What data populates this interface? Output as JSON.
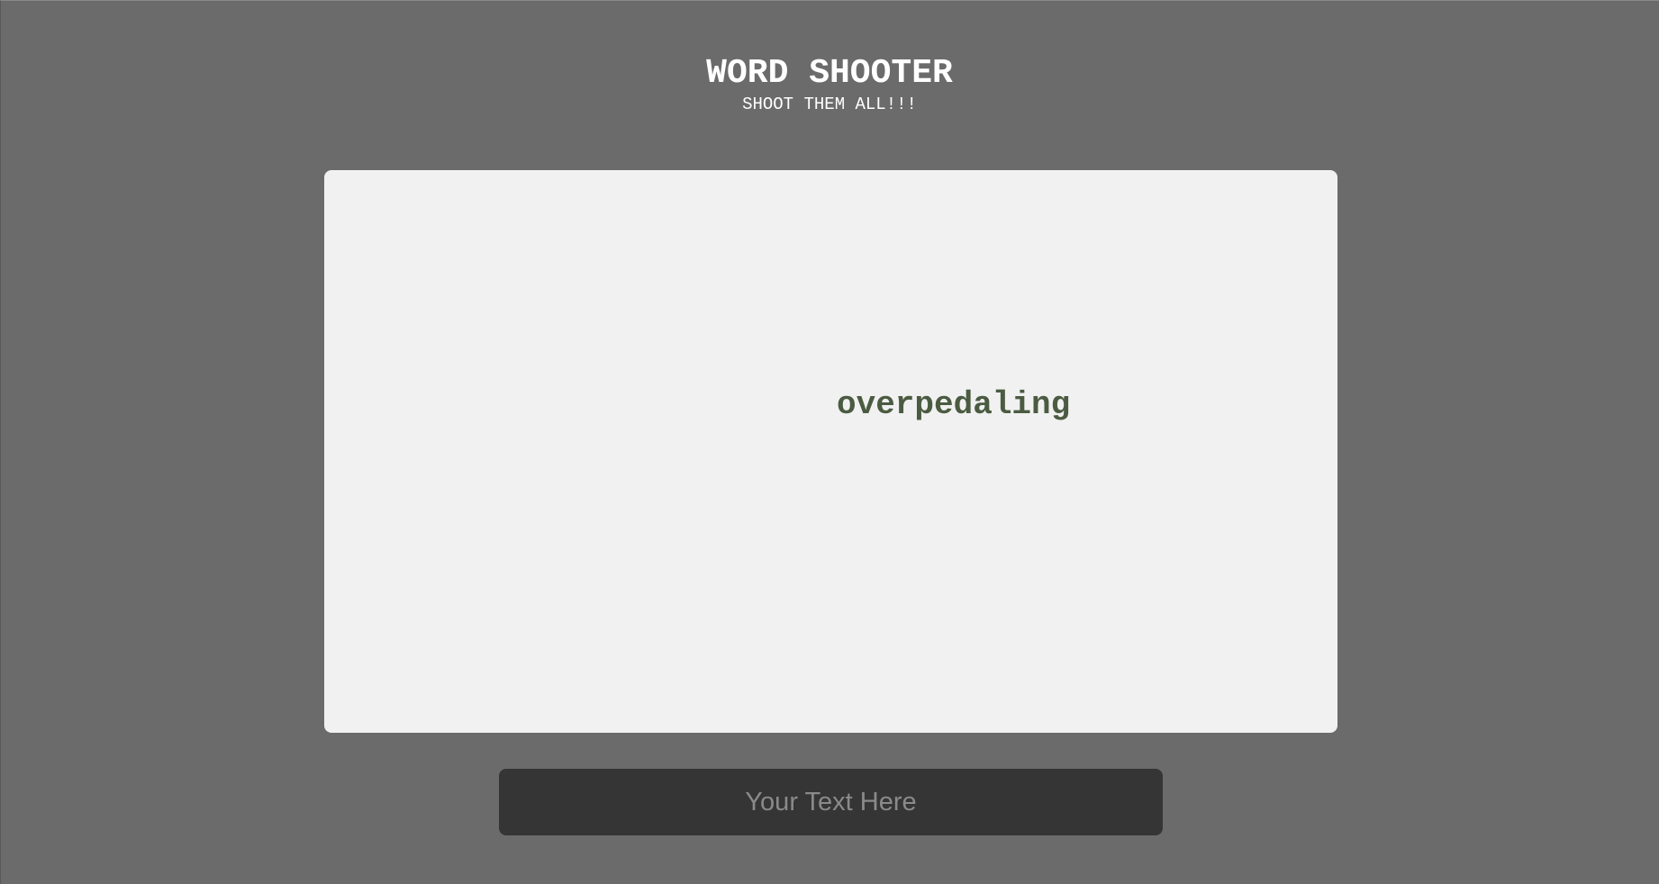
{
  "header": {
    "title": "WORD SHOOTER",
    "subtitle": "SHOOT THEM ALL!!!"
  },
  "game": {
    "words": [
      {
        "text": "overpedaling",
        "color": "#4b5b41"
      }
    ]
  },
  "input": {
    "value": "",
    "placeholder": "Your Text Here"
  },
  "colors": {
    "background": "#6b6b6b",
    "play_area": "#f1f1f1",
    "input_background": "#353535",
    "title_text": "#ffffff"
  }
}
